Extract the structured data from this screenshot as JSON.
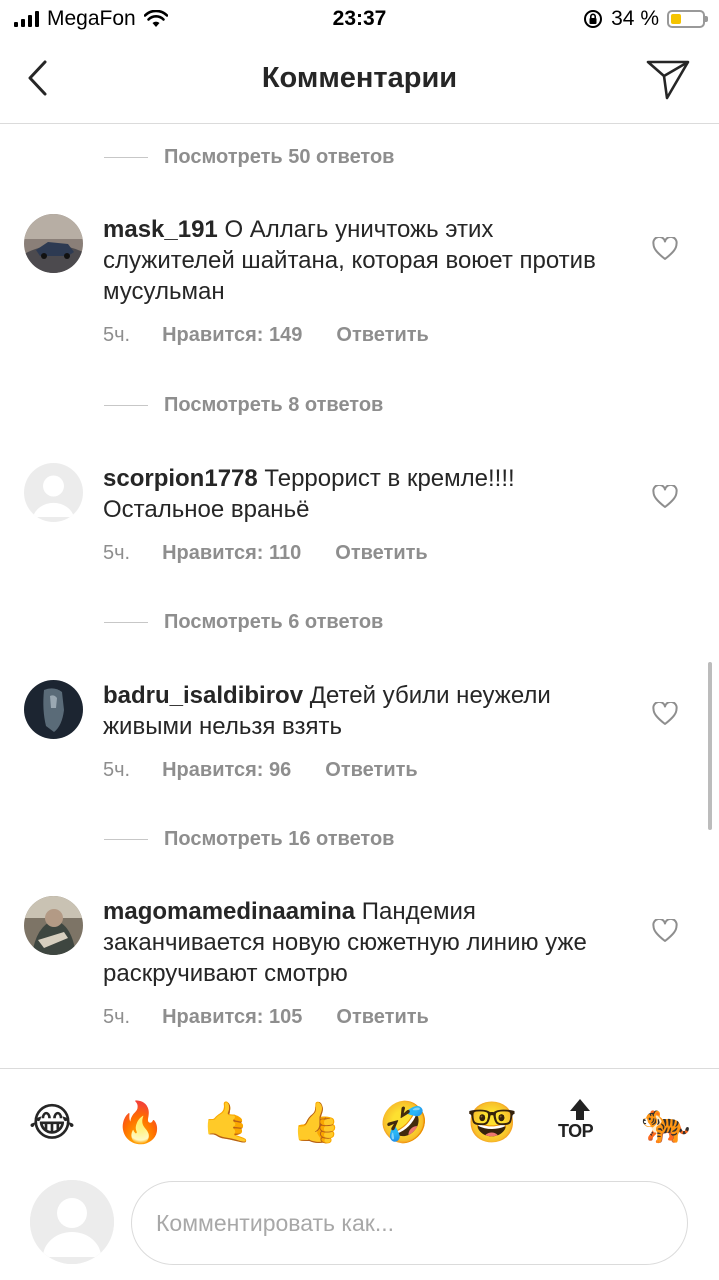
{
  "status_bar": {
    "carrier": "MegaFon",
    "time": "23:37",
    "battery_percent": "34 %",
    "battery_level": 0.34,
    "battery_color": "#f5c400"
  },
  "header": {
    "title": "Комментарии",
    "back_icon": "chevron-left-icon",
    "send_icon": "paper-plane-icon"
  },
  "view_replies": [
    "Посмотреть 50 ответов",
    "Посмотреть 8 ответов",
    "Посмотреть 6 ответов",
    "Посмотреть 16 ответов"
  ],
  "comments": [
    {
      "username": "mask_191",
      "text": "О Аллагь уничтожь этих служителей шайтана, которая воюет против мусульман",
      "time": "5ч.",
      "likes": "Нравится: 149",
      "reply": "Ответить"
    },
    {
      "username": "scorpion1778",
      "text": "Террорист в кремле!!!! Остальное враньё",
      "time": "5ч.",
      "likes": "Нравится: 110",
      "reply": "Ответить"
    },
    {
      "username": "badru_isaldibirov",
      "text": "Детей убили неужели живыми нельзя взять",
      "time": "5ч.",
      "likes": "Нравится: 96",
      "reply": "Ответить"
    },
    {
      "username": "magomamedinaamina",
      "text": "Пандемия заканчивается новую сюжетную линию уже раскручивают смотрю",
      "time": "5ч.",
      "likes": "Нравится: 105",
      "reply": "Ответить"
    }
  ],
  "quick_reactions": {
    "emojis": [
      "😂",
      "🔥",
      "🤙",
      "👍",
      "🤣",
      "🤓",
      "🐅"
    ],
    "top_label": "TOP"
  },
  "composer": {
    "placeholder": "Комментировать как..."
  },
  "colors": {
    "text": "#262626",
    "secondary": "#8e8e8e",
    "divider": "#dbdbdb"
  }
}
